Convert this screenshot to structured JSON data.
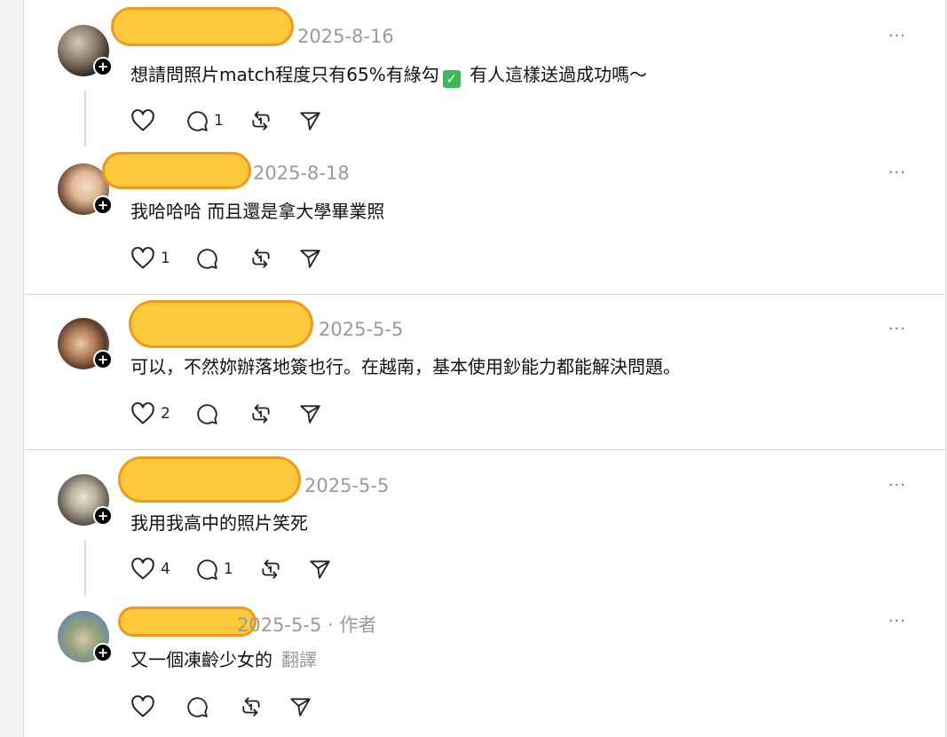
{
  "posts": [
    {
      "date": "2025-8-16",
      "text_before_icon": "想請問照片match程度只有65%有綠勾",
      "text_after_icon": " 有人這樣送過成功嗎～",
      "check_icon": "check-mark-button-icon",
      "likes": "",
      "replies": "1",
      "more": "···"
    },
    {
      "date": "2025-8-18",
      "text": "我哈哈哈 而且還是拿大學畢業照",
      "likes": "1",
      "replies": "",
      "more": "···"
    },
    {
      "date": "2025-5-5",
      "text": "可以，不然妳辦落地簽也行。在越南，基本使用鈔能力都能解決問題。",
      "likes": "2",
      "replies": "",
      "more": "···"
    },
    {
      "date": "2025-5-5",
      "text": "我用我高中的照片笑死",
      "likes": "4",
      "replies": "1",
      "more": "···"
    },
    {
      "date": "2025-5-5 · 作者",
      "text": "又一個凍齡少女的",
      "translate": "翻譯",
      "likes": "",
      "replies": "",
      "more": "···"
    }
  ],
  "icons": {
    "like": "heart-icon",
    "reply": "comment-bubble-icon",
    "repost": "repost-icon",
    "share": "send-icon",
    "follow": "plus-icon"
  },
  "colors": {
    "name_redaction_fill": "#fdc83b",
    "name_redaction_border": "#ef9a1c",
    "meta": "#9a9a9a"
  }
}
